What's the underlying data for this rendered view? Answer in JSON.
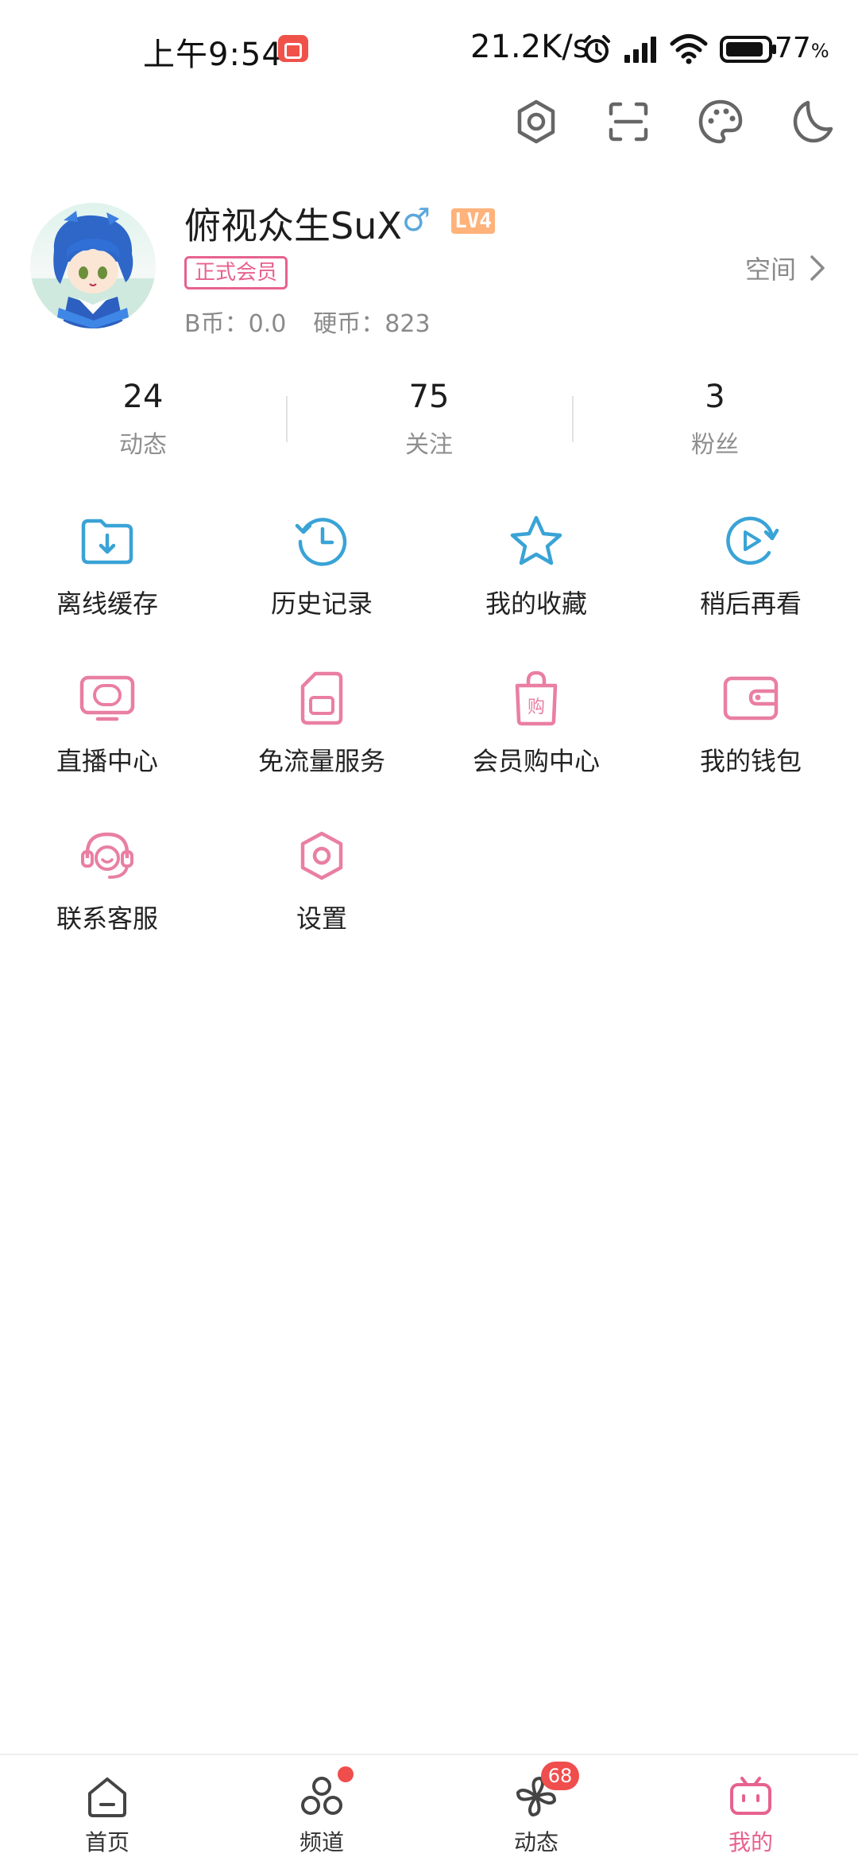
{
  "status_bar": {
    "time": "上午9:54",
    "network_speed": "21.2K/s",
    "battery": "77",
    "battery_unit": "%"
  },
  "top_actions": [
    {
      "icon": "settings-hex-icon"
    },
    {
      "icon": "scan-icon"
    },
    {
      "icon": "theme-palette-icon"
    },
    {
      "icon": "night-mode-icon"
    }
  ],
  "profile": {
    "username": "俯视众生SuX",
    "gender_symbol": "♂",
    "level": "LV4",
    "member_badge": "正式会员",
    "b_coin": "B币：0.0",
    "hard_coin": "硬币：823",
    "space_label": "空间"
  },
  "stats": [
    {
      "value": "24",
      "label": "动态"
    },
    {
      "value": "75",
      "label": "关注"
    },
    {
      "value": "3",
      "label": "粉丝"
    }
  ],
  "menu": [
    {
      "label": "离线缓存",
      "icon": "offline-cache-icon",
      "color": "#3aa3d6"
    },
    {
      "label": "历史记录",
      "icon": "history-icon",
      "color": "#3aa3d6"
    },
    {
      "label": "我的收藏",
      "icon": "star-icon",
      "color": "#3aa3d6"
    },
    {
      "label": "稍后再看",
      "icon": "watch-later-icon",
      "color": "#3aa3d6"
    },
    {
      "label": "直播中心",
      "icon": "live-tv-icon",
      "color": "#e97fa2"
    },
    {
      "label": "免流量服务",
      "icon": "sim-card-icon",
      "color": "#e97fa2"
    },
    {
      "label": "会员购中心",
      "icon": "shopping-bag-icon",
      "color": "#e97fa2"
    },
    {
      "label": "我的钱包",
      "icon": "wallet-icon",
      "color": "#e97fa2"
    },
    {
      "label": "联系客服",
      "icon": "customer-service-icon",
      "color": "#e97fa2"
    },
    {
      "label": "设置",
      "icon": "settings-icon",
      "color": "#e97fa2"
    }
  ],
  "bottom_nav": [
    {
      "label": "首页",
      "icon": "home-icon"
    },
    {
      "label": "频道",
      "icon": "channel-icon"
    },
    {
      "label": "动态",
      "icon": "dynamic-icon",
      "badge": "68"
    },
    {
      "label": "我的",
      "icon": "tv-mine-icon"
    }
  ],
  "colors": {
    "accent_pink": "#e7628e",
    "accent_blue": "#3aa3d6",
    "badge_red": "#f04d4d"
  }
}
